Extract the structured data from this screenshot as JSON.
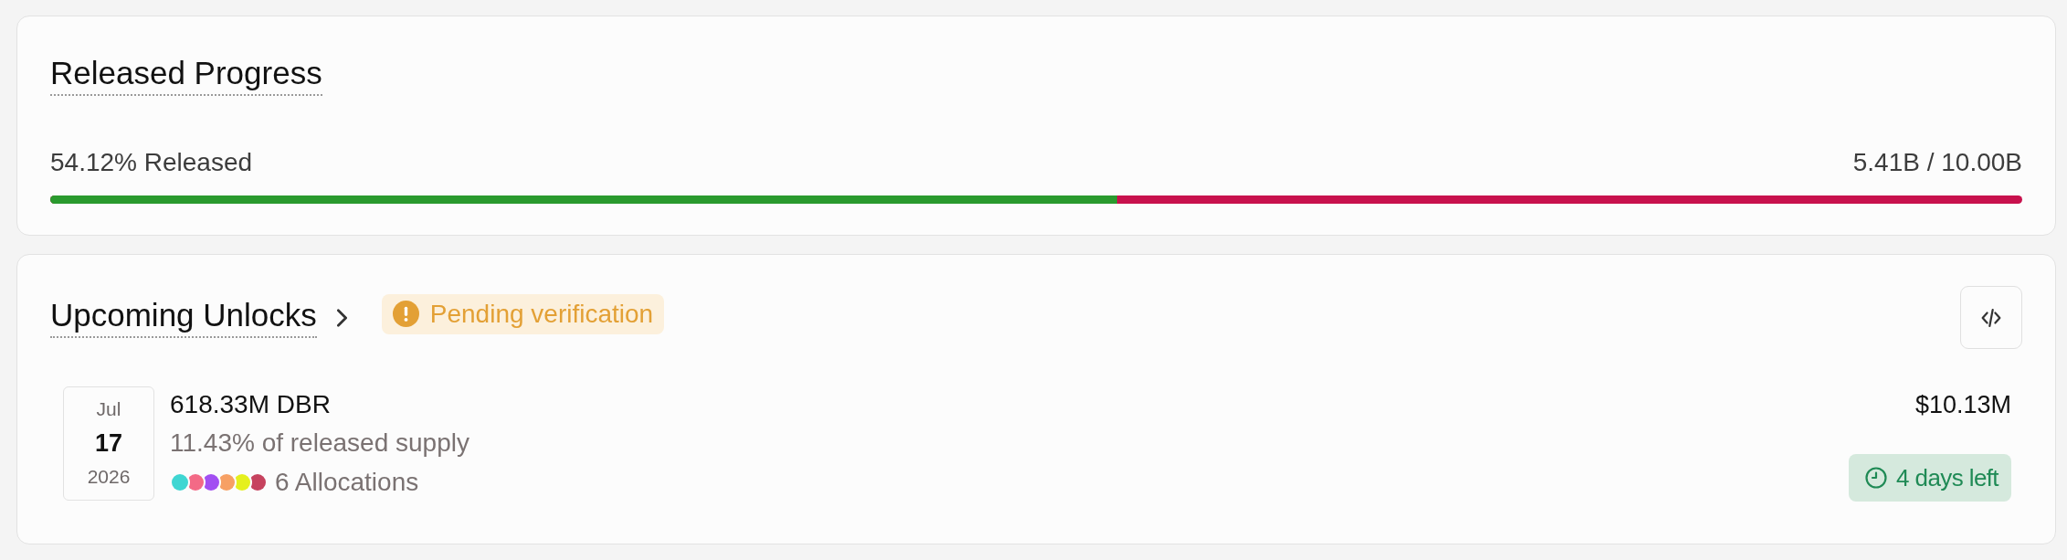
{
  "released_progress": {
    "title": "Released Progress",
    "released_label": "54.12% Released",
    "supply_label": "5.41B / 10.00B",
    "level": 0.5412
  },
  "upcoming_unlocks": {
    "title": "Upcoming Unlocks",
    "status_badge": {
      "kind": "warning",
      "label": "Pending verification"
    },
    "unlocks": [
      {
        "month": "Jul",
        "day": "17",
        "year": "2026",
        "amount": "618.33M DBR",
        "share": "11.43% of released supply",
        "allocations": [
          {
            "color": "#3fd6d2"
          },
          {
            "color": "#f36a86"
          },
          {
            "color": "#a24ff2"
          },
          {
            "color": "#f7a064"
          },
          {
            "color": "#e5f01e"
          },
          {
            "color": "#c6425e"
          }
        ],
        "allocations_label": "6 Allocations",
        "value": "$10.13M",
        "time_left": "4 days left"
      }
    ]
  }
}
